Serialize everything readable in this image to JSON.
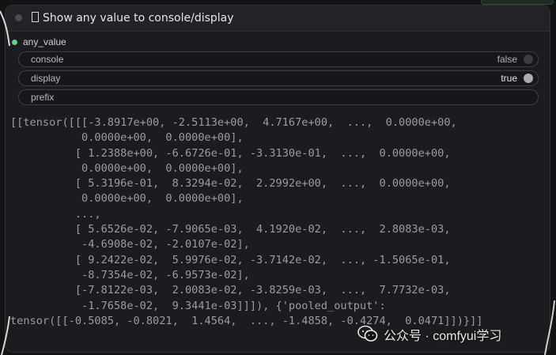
{
  "node": {
    "title": "Show any value to console/display"
  },
  "input": {
    "label": "any_value"
  },
  "widgets": {
    "console": {
      "label": "console",
      "value": "false"
    },
    "display": {
      "label": "display",
      "value": "true"
    },
    "prefix": {
      "label": "prefix",
      "value": ""
    }
  },
  "output": {
    "lines": [
      "[[tensor([[[-3.8917e+00, -2.5113e+00,  4.7167e+00,  ...,  0.0000e+00,",
      "           0.0000e+00,  0.0000e+00],",
      "          [ 1.2388e+00, -6.6726e-01, -3.3130e-01,  ...,  0.0000e+00,",
      "           0.0000e+00,  0.0000e+00],",
      "          [ 5.3196e-01,  8.3294e-02,  2.2992e+00,  ...,  0.0000e+00,",
      "           0.0000e+00,  0.0000e+00],",
      "          ...,",
      "          [ 5.6526e-02, -7.9065e-03,  4.1920e-02,  ...,  2.8083e-03,",
      "           -4.6908e-02, -2.0107e-02],",
      "          [ 9.2422e-02,  5.9976e-02, -3.7142e-02,  ..., -1.5065e-01,",
      "           -8.7354e-02, -6.9573e-02],",
      "          [-7.8122e-03,  2.0083e-02, -3.8259e-03,  ...,  7.7732e-03,",
      "           -1.7658e-02,  9.3441e-03]]]), {'pooled_output':",
      "tensor([[-0.5085, -0.8021,  1.4564,  ..., -1.4858, -0.4274,  0.0471]])}]]"
    ]
  },
  "watermark": {
    "text": "公众号 · comfyui学习",
    "icon": "wechat-icon"
  },
  "colors": {
    "input_dot": "#5fd18b",
    "node_bg": "#1b1c1f",
    "output_text": "#9a9ca3"
  }
}
